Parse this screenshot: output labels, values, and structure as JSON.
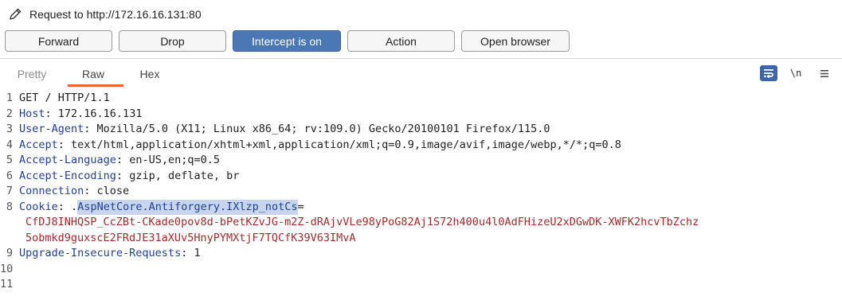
{
  "window": {
    "title": "Request to http://172.16.16.131:80"
  },
  "toolbar": {
    "forward": "Forward",
    "drop": "Drop",
    "intercept": "Intercept is on",
    "action": "Action",
    "open_browser": "Open browser"
  },
  "tabs": {
    "pretty": "Pretty",
    "raw": "Raw",
    "hex": "Hex",
    "newline_toggle": "\\n"
  },
  "colors": {
    "accent": "#4a78b5",
    "tab_underline": "#e8692b",
    "header_name": "#23418f",
    "cookie_value": "#9b2d2d"
  },
  "request": {
    "lines": [
      {
        "num": "1",
        "text": "GET / HTTP/1.1"
      },
      {
        "num": "2",
        "name": "Host",
        "value": " 172.16.16.131"
      },
      {
        "num": "3",
        "name": "User-Agent",
        "value": " Mozilla/5.0 (X11; Linux x86_64; rv:109.0) Gecko/20100101 Firefox/115.0"
      },
      {
        "num": "4",
        "name": "Accept",
        "value": " text/html,application/xhtml+xml,application/xml;q=0.9,image/avif,image/webp,*/*;q=0.8"
      },
      {
        "num": "5",
        "name": "Accept-Language",
        "value": " en-US,en;q=0.5"
      },
      {
        "num": "6",
        "name": "Accept-Encoding",
        "value": " gzip, deflate, br"
      },
      {
        "num": "7",
        "name": "Connection",
        "value": " close"
      },
      {
        "num": "8",
        "name": "Cookie",
        "value": " ."
      },
      {
        "num": "9",
        "name": "Upgrade-Insecure-Requests",
        "value": " 1"
      },
      {
        "num": "10"
      },
      {
        "num": "11"
      }
    ],
    "cookie": {
      "name": "AspNetCore.Antiforgery.IXlzp_notCs",
      "eq": "=",
      "value_lines": [
        "CfDJ8INHQSP_CcZBt-CKade0pov8d-bPetKZvJG-m2Z-dRAjvVLe98yPoG82Aj1S72h400u4l0AdFHizeU2xDGwDK-XWFK2hcvTbZchz",
        "5obmkd9guxscE2FRdJE31aXUv5HnyPYMXtjF7TQCfK39V63IMvA"
      ]
    }
  }
}
